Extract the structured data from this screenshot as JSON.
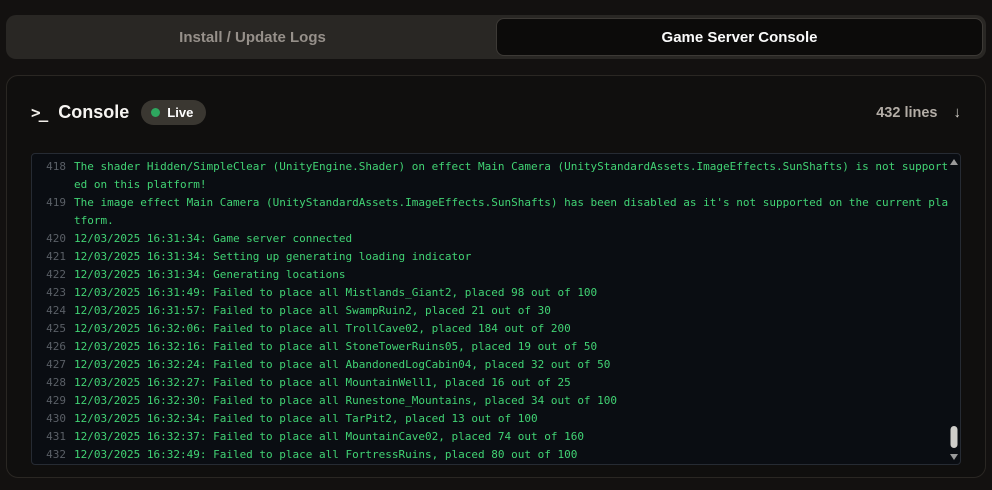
{
  "tabs": [
    {
      "label": "Install / Update Logs",
      "active": false
    },
    {
      "label": "Game Server Console",
      "active": true
    }
  ],
  "console": {
    "title": "Console",
    "live_label": "Live",
    "lines_count": "432 lines",
    "icons": {
      "terminal": ">_",
      "scroll_down": "↓"
    },
    "colors": {
      "log_text_green": "#41d374",
      "line_number_gray": "#5a5f66",
      "live_dot_green": "#2ea75f",
      "log_background": "#0a0d12",
      "active_tab_text": "#fafafa",
      "inactive_tab_text": "#96908a"
    },
    "log_lines": [
      {
        "num": "418",
        "text": "The shader Hidden/SimpleClear (UnityEngine.Shader) on effect Main Camera (UnityStandardAssets.ImageEffects.SunShafts) is not supported on this platform!"
      },
      {
        "num": "419",
        "text": "The image effect Main Camera (UnityStandardAssets.ImageEffects.SunShafts) has been disabled as it's not supported on the current platform."
      },
      {
        "num": "420",
        "text": "12/03/2025 16:31:34: Game server connected"
      },
      {
        "num": "421",
        "text": "12/03/2025 16:31:34: Setting up generating loading indicator"
      },
      {
        "num": "422",
        "text": "12/03/2025 16:31:34: Generating locations"
      },
      {
        "num": "423",
        "text": "12/03/2025 16:31:49: Failed to place all Mistlands_Giant2, placed 98 out of 100"
      },
      {
        "num": "424",
        "text": "12/03/2025 16:31:57: Failed to place all SwampRuin2, placed 21 out of 30"
      },
      {
        "num": "425",
        "text": "12/03/2025 16:32:06: Failed to place all TrollCave02, placed 184 out of 200"
      },
      {
        "num": "426",
        "text": "12/03/2025 16:32:16: Failed to place all StoneTowerRuins05, placed 19 out of 50"
      },
      {
        "num": "427",
        "text": "12/03/2025 16:32:24: Failed to place all AbandonedLogCabin04, placed 32 out of 50"
      },
      {
        "num": "428",
        "text": "12/03/2025 16:32:27: Failed to place all MountainWell1, placed 16 out of 25"
      },
      {
        "num": "429",
        "text": "12/03/2025 16:32:30: Failed to place all Runestone_Mountains, placed 34 out of 100"
      },
      {
        "num": "430",
        "text": "12/03/2025 16:32:34: Failed to place all TarPit2, placed 13 out of 100"
      },
      {
        "num": "431",
        "text": "12/03/2025 16:32:37: Failed to place all MountainCave02, placed 74 out of 160"
      },
      {
        "num": "432",
        "text": "12/03/2025 16:32:49: Failed to place all FortressRuins, placed 80 out of 100"
      }
    ]
  }
}
